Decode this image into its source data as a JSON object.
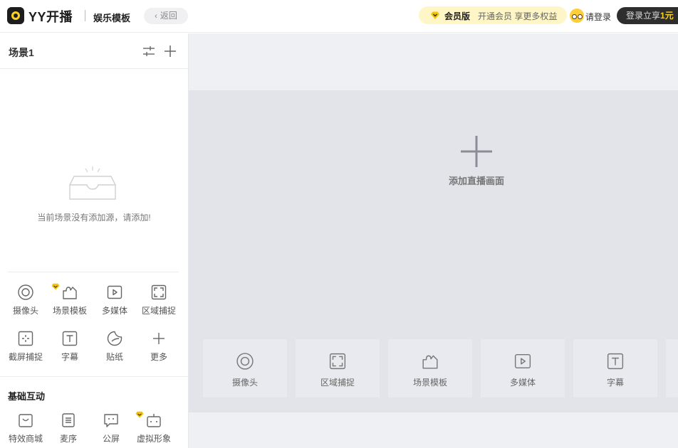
{
  "header": {
    "app_name": "YY开播",
    "page_title": "娱乐模板",
    "back_label": "返回",
    "vip_label": "会员版",
    "vip_desc": "开通会员 享更多权益",
    "login_label": "请登录",
    "promo_prefix": "登录立享",
    "promo_highlight": "1元",
    "accent": "#ffd21e"
  },
  "left_panel": {
    "scene_name": "场景1",
    "empty_text": "当前场景没有添加源，请添加!",
    "sources": [
      {
        "label": "摄像头",
        "icon": "camera-icon"
      },
      {
        "label": "场景模板",
        "icon": "puzzle-icon",
        "vip": true
      },
      {
        "label": "多媒体",
        "icon": "play-icon"
      },
      {
        "label": "区域捕捉",
        "icon": "region-capture-icon"
      },
      {
        "label": "截屏捕捉",
        "icon": "screen-capture-icon"
      },
      {
        "label": "字幕",
        "icon": "text-icon"
      },
      {
        "label": "贴纸",
        "icon": "sticker-icon"
      },
      {
        "label": "更多",
        "icon": "plus-icon"
      }
    ],
    "interaction_title": "基础互动",
    "interactions": [
      {
        "label": "特效商城",
        "icon": "shop-icon"
      },
      {
        "label": "麦序",
        "icon": "list-icon"
      },
      {
        "label": "公屏",
        "icon": "chat-icon"
      },
      {
        "label": "虚拟形象",
        "icon": "robot-icon",
        "vip": true
      }
    ]
  },
  "main": {
    "add_live_label": "添加直播画面",
    "quick_sources": [
      {
        "label": "摄像头",
        "icon": "camera-icon"
      },
      {
        "label": "区域捕捉",
        "icon": "region-capture-icon"
      },
      {
        "label": "场景模板",
        "icon": "puzzle-icon"
      },
      {
        "label": "多媒体",
        "icon": "play-icon"
      },
      {
        "label": "字幕",
        "icon": "text-icon"
      }
    ]
  }
}
